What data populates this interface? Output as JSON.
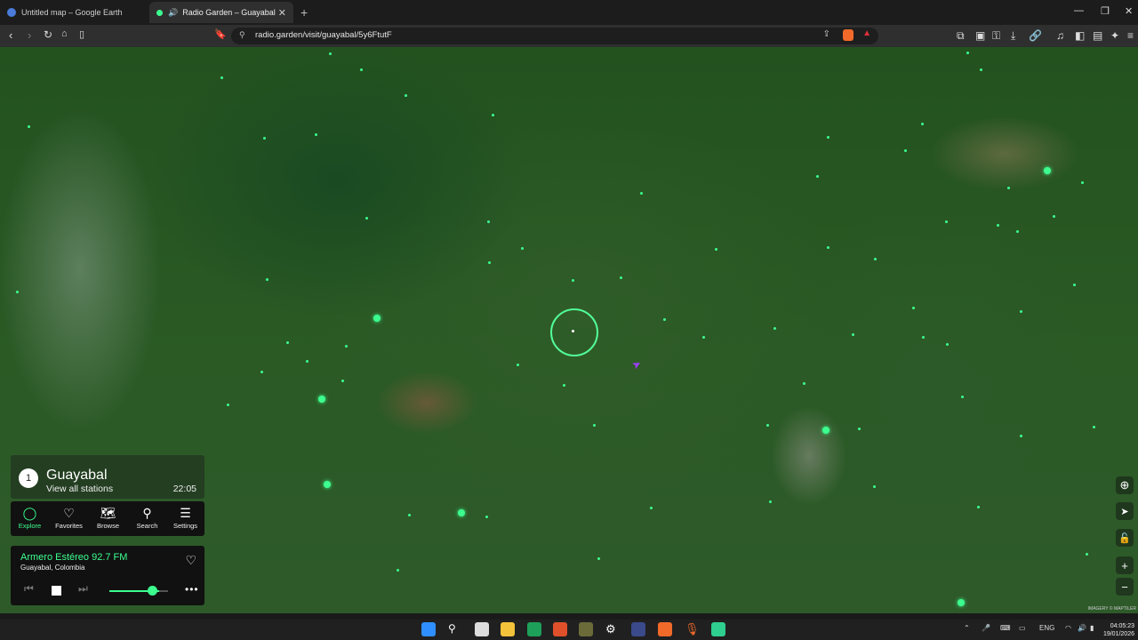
{
  "browser": {
    "tabs": [
      {
        "title": "Untitled map – Google Earth",
        "active": false
      },
      {
        "title": "Radio Garden – Guayabal",
        "active": true
      }
    ],
    "url": "radio.garden/visit/guayabal/5y6FtutF"
  },
  "place": {
    "count": "1",
    "title": "Guayabal",
    "view_all": "View all stations",
    "time": "22:05"
  },
  "nav": [
    {
      "label": "Explore",
      "icon": "explore-icon",
      "active": true
    },
    {
      "label": "Favorites",
      "icon": "heart-icon"
    },
    {
      "label": "Browse",
      "icon": "map-icon"
    },
    {
      "label": "Search",
      "icon": "search-icon"
    },
    {
      "label": "Settings",
      "icon": "menu-icon"
    }
  ],
  "player": {
    "station": "Armero Estéreo 92.7 FM",
    "location": "Guayabal, Colombia",
    "volume_fraction": 0.78
  },
  "map": {
    "attribution": "IMAGERY © MAPTILER"
  },
  "taskbar": {
    "lang": "ENG",
    "time": "04:05:23",
    "date": "19/01/2026"
  },
  "colors": {
    "accent": "#3cff8f",
    "panel": "#111111"
  }
}
